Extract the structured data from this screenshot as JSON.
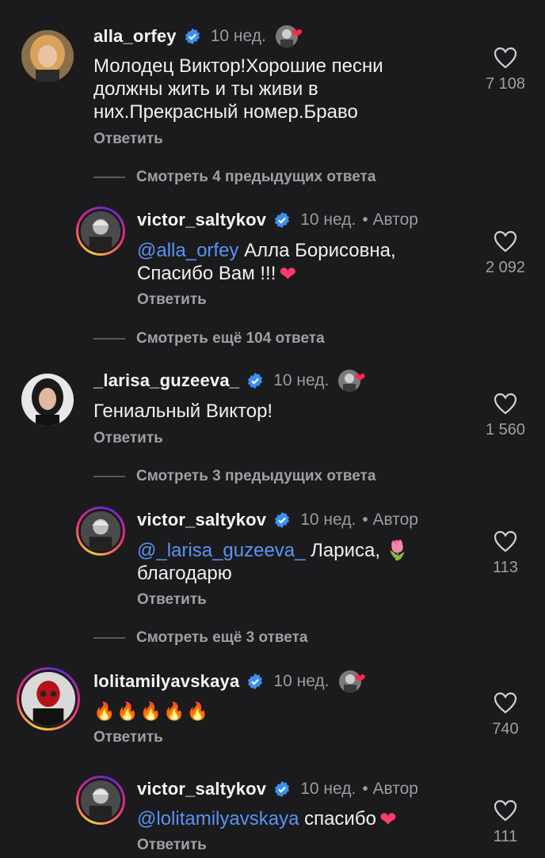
{
  "comments": [
    {
      "username": "alla_orfey",
      "time": "10 нед.",
      "lines": [
        "Молодец Виктор!Хорошие песни",
        "должны жить и ты живи в",
        "них.Прекрасный номер.Браво"
      ],
      "reply_label": "Ответить",
      "likes": "7 108"
    },
    {
      "view_more": "Смотреть 4 предыдущих ответа"
    },
    {
      "username": "victor_saltykov",
      "time": "10 нед.",
      "author": "• Автор",
      "mention": "@alla_orfey",
      "line1_rest": " Алла Борисовна,",
      "line2": "Спасибо Вам !!!",
      "reply_label": "Ответить",
      "likes": "2 092"
    },
    {
      "view_more": "Смотреть ещё 104 ответа"
    },
    {
      "username": "_larisa_guzeeva_",
      "time": "10 нед.",
      "line1": "Гениальный Виктор!",
      "reply_label": "Ответить",
      "likes": "1 560"
    },
    {
      "view_more": "Смотреть 3 предыдущих ответа"
    },
    {
      "username": "victor_saltykov",
      "time": "10 нед.",
      "author": "• Автор",
      "mention": "@_larisa_guzeeva_",
      "line1_rest": "  Лариса,",
      "line2": "благодарю",
      "reply_label": "Ответить",
      "likes": "113"
    },
    {
      "view_more": "Смотреть ещё 3 ответа"
    },
    {
      "username": "lolitamilyavskaya",
      "time": "10 нед.",
      "fire": "🔥🔥🔥🔥🔥",
      "reply_label": "Ответить",
      "likes": "740"
    },
    {
      "username": "victor_saltykov",
      "time": "10 нед.",
      "author": "• Автор",
      "mention": "@lolitamilyavskaya",
      "line1_rest": " спасибо",
      "reply_label": "Ответить",
      "likes": "111"
    }
  ],
  "colors": {
    "background": "#1b1b1d",
    "mention": "#5b93f5",
    "verified": "#3b8ff0",
    "like_heart": "#ff3b6b",
    "muted": "#a0a0a4"
  },
  "icons": [
    "verified-badge-icon",
    "heart-outline-icon",
    "heart-filled-icon",
    "story-ring",
    "tulip-emoji",
    "fire-emoji"
  ]
}
